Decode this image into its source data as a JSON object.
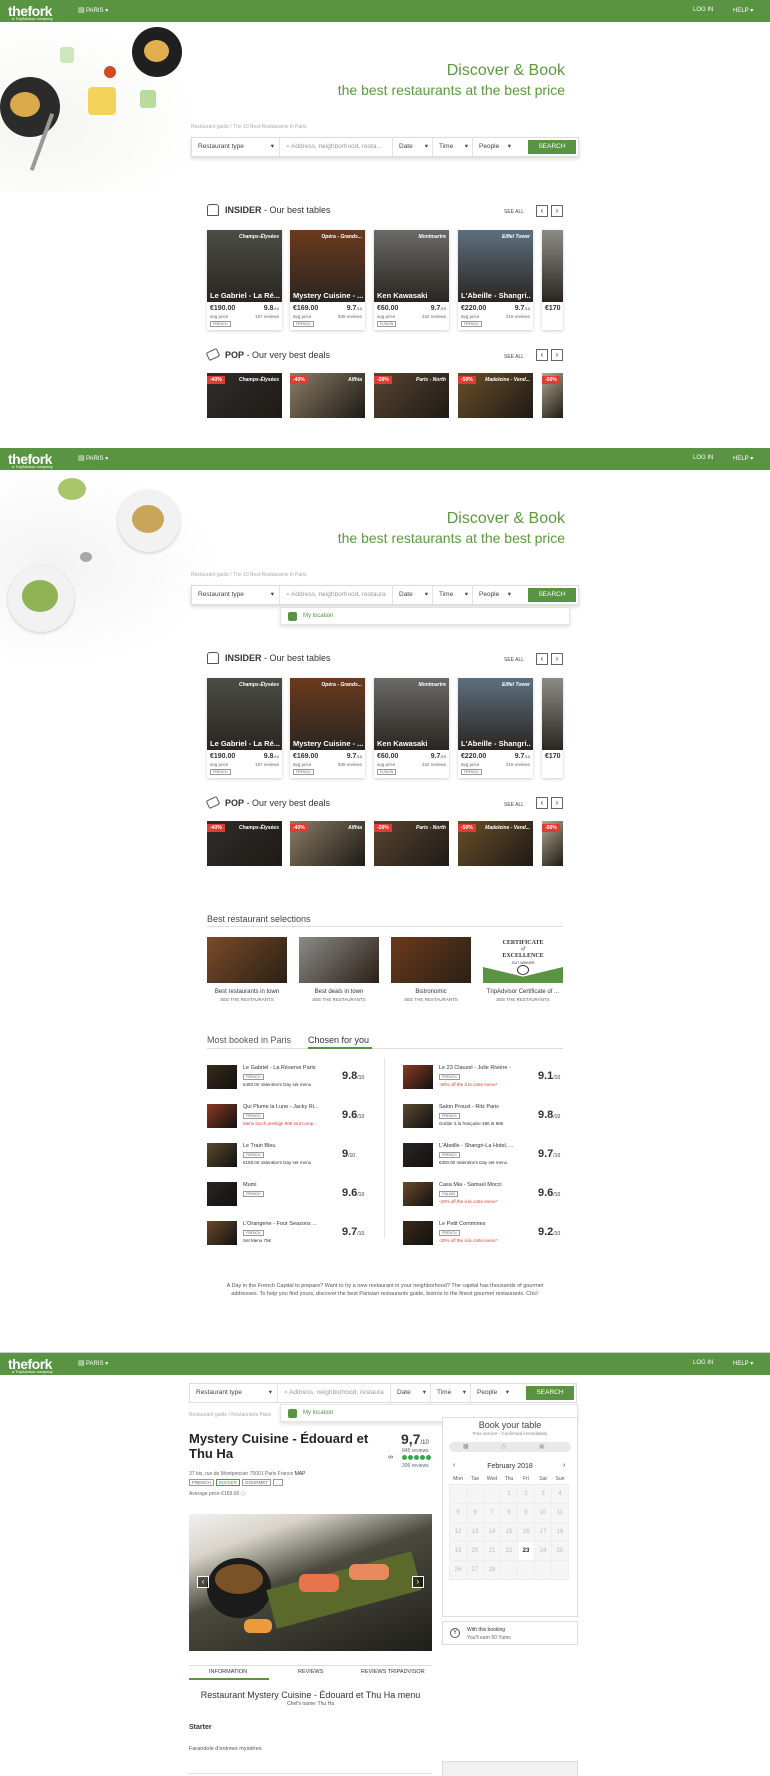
{
  "header": {
    "logo": "thefork",
    "logo_sub": "a TripAdvisor company",
    "city": "PARIS",
    "login": "LOG IN",
    "help": "HELP"
  },
  "hero": {
    "title_line1": "Discover & Book",
    "title_line2": "the best restaurants at the best price",
    "breadcrumb": "Restaurant guide  /  The 10 Best Restaurants in Paris"
  },
  "search": {
    "type": "Restaurant type",
    "placeholder": "Address, neighborhood, resta...",
    "placeholder_full": "Address, neighborhood, restaura",
    "date": "Date",
    "time": "Time",
    "people": "People",
    "button": "SEARCH",
    "my_location": "My location"
  },
  "insider": {
    "label": "INSIDER",
    "subtitle": " - Our best tables",
    "see_all": "SEE ALL",
    "cards": [
      {
        "area": "Champs-Élysées",
        "name": "Le Gabriel - La Ré...",
        "price": "€190.00",
        "rating": "9.8",
        "reviews": "187 reviews",
        "tag": "FRENCH"
      },
      {
        "area": "Opéra - Grands...",
        "name": "Mystery Cuisine - ...",
        "price": "€169.00",
        "rating": "9.7",
        "reviews": "845 reviews",
        "tag": "FRENCH"
      },
      {
        "area": "Montmartre",
        "name": "Ken Kawasaki",
        "price": "€60.00",
        "rating": "9.7",
        "reviews": "342 reviews",
        "tag": "FUSION"
      },
      {
        "area": "Eiffel Tower",
        "name": "L'Abeille - Shangri...",
        "price": "€220.00",
        "rating": "9.7",
        "reviews": "216 reviews",
        "tag": "FRENCH"
      },
      {
        "area": "",
        "name": "",
        "price": "€170",
        "rating": "",
        "reviews": "",
        "tag": ""
      }
    ],
    "card_name_alt": "L'Abeille - Shangri-L...",
    "card_name_alt2": "Le Gabriel - La Rés...",
    "avg_price": "avg price",
    "rating_suffix": "/10"
  },
  "pop": {
    "label": "POP",
    "subtitle": " - Our very best deals",
    "see_all": "SEE ALL",
    "deals": [
      {
        "pct": "-40%",
        "area": "Champs-Élysées"
      },
      {
        "pct": "-40%",
        "area": "Alfhia"
      },
      {
        "pct": "-30%",
        "area": "Paris - North"
      },
      {
        "pct": "-50%",
        "area": "Madeleine - Vend..."
      },
      {
        "pct": "-50%",
        "area": ""
      }
    ]
  },
  "selections": {
    "title": "Best restaurant selections",
    "items": [
      {
        "label": "Best restaurants in town",
        "link": "SEE THE RESTAURANTS"
      },
      {
        "label": "Best deals in town",
        "link": "SEE THE RESTAURANTS"
      },
      {
        "label": "Bistronomic",
        "link": "SEE THE RESTAURANTS"
      },
      {
        "label": "TripAdvisor Certificate of ...",
        "link": "SEE THE RESTAURANTS"
      }
    ],
    "cert_line1": "CERTIFICATE",
    "cert_of": "of",
    "cert_line2": "EXCELLENCE",
    "cert_line3": "2017 WINNER"
  },
  "most": {
    "tab1": "Most booked in Paris",
    "tab2": "Chosen for you",
    "left": [
      {
        "name": "Le Gabriel - La Réserve Paris",
        "tag": "FRENCH",
        "offer": "€450.00 Valentine's Day set menu",
        "red": false,
        "rating": "9.8"
      },
      {
        "name": "Qui Plume la Lune - Jacky Ri...",
        "tag": "FRENCH",
        "offer": "Menu lunch prestige 90€ tout comp...",
        "red": true,
        "rating": "9.6"
      },
      {
        "name": "Le Train Bleu",
        "tag": "FRENCH",
        "offer": "€158.00 Valentine's Day set menu",
        "red": false,
        "rating": "9"
      },
      {
        "name": "Mumi",
        "tag": "FRENCH",
        "offer": "",
        "red": false,
        "rating": "9.6"
      },
      {
        "name": "L'Orangerie - Four Seasons ...",
        "tag": "FRENCH",
        "offer": "Set Menu 75€",
        "red": false,
        "rating": "9.7"
      }
    ],
    "right": [
      {
        "name": "Le 23 Clauzel - Julie Rivière -",
        "tag": "FRENCH",
        "offer": "-50% off the à la carte menu*",
        "red": true,
        "rating": "9.1"
      },
      {
        "name": "Salon Proust - Ritz Paris",
        "tag": "FRENCH",
        "offer": "Goûter à la française 48€ et 86€",
        "red": false,
        "rating": "9.8"
      },
      {
        "name": "L'Abeille - Shangri-La Hotel, ...",
        "tag": "FRENCH",
        "offer": "€300.00 Valentine's Day set menu",
        "red": false,
        "rating": "9.7"
      },
      {
        "name": "Casa Mia - Samuel Mocci",
        "tag": "ITALIAN",
        "offer": "-20% off the à la carte menu*",
        "red": true,
        "rating": "9.6"
      },
      {
        "name": "Le Petit Commines",
        "tag": "FRENCH",
        "offer": "-30% off the à la carte menu*",
        "red": true,
        "rating": "9.2"
      }
    ],
    "suffix": "/10"
  },
  "footer_text": "A Day in the French Capital to prepare? Want to try a new restaurant in your neighborhood? The capital has thousands of gourmet addresses. To help you find yours, discover the best Parisian restaurants guide, bistros to the finest gourmet restaurants. Chic!",
  "detail": {
    "breadcrumb": "Restaurant guide  /  Restaurants Paris",
    "name_line1": "Mystery Cuisine - Édouard et",
    "name_line2": "Thu Ha",
    "rating": "9,7",
    "rating_suffix": "/10",
    "reviews": "845 reviews",
    "ta_reviews": "306 reviews",
    "address": "37 bis, rue de Montpensier 75001 Paris France",
    "map": "MAP",
    "tags": [
      "FRENCH",
      "INSIDER",
      "GOURMET",
      "..."
    ],
    "avg_price": "Average price €169.00",
    "tabs": [
      "INFORMATION",
      "REVIEWS",
      "REVIEWS TRIPADVISOR"
    ],
    "menu_title": "Restaurant Mystery Cuisine - Édouard et Thu Ha menu",
    "chef": "Chef's name: Thu Ha",
    "starter": "Starter",
    "starter_item": "Farandole d'entrées mystères"
  },
  "booking": {
    "title": "Book your table",
    "sub": "Free service - Confirmed immediately",
    "month": "February 2018",
    "days": [
      "Mon",
      "Tue",
      "Wed",
      "Thu",
      "Fri",
      "Sat",
      "Sun"
    ],
    "weeks": [
      [
        "",
        "",
        "",
        "1",
        "2",
        "3",
        "4"
      ],
      [
        "5",
        "6",
        "7",
        "8",
        "9",
        "10",
        "11"
      ],
      [
        "12",
        "13",
        "14",
        "15",
        "16",
        "17",
        "18"
      ],
      [
        "19",
        "20",
        "21",
        "22",
        "23",
        "24",
        "25"
      ],
      [
        "26",
        "27",
        "28",
        "",
        "",
        "",
        ""
      ]
    ],
    "today": "23",
    "yums_line1": "With this booking",
    "yums_line2": "You'll earn 50 Yums"
  },
  "colors": {
    "brand": "#589442",
    "accent_text": "#5a9a3c",
    "deal_red": "#e03c31"
  }
}
